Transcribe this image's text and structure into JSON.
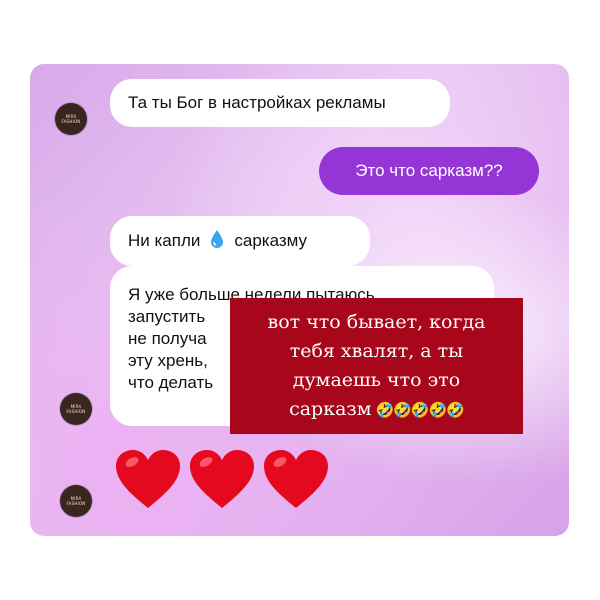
{
  "avatar": {
    "brand_line1": "MIRA",
    "brand_line2": "FASHION"
  },
  "messages": {
    "m1": "Та ты Бог в настройках рекламы",
    "m2": "Это что сарказм??",
    "m3_before": "Ни капли",
    "m3_emoji": "💧",
    "m3_after": "сарказму",
    "m4_lines": [
      "Я уже больше недели пытаюсь",
      "запустить",
      "не получа",
      "эту хрень,",
      "что делать"
    ]
  },
  "overlay": {
    "lines": [
      "вот что бывает, когда",
      "тебя хвалят, а ты",
      "думаешь что это"
    ],
    "last_word": "сарказм",
    "emojis": "🤣🤣🤣🤣🤣"
  },
  "hearts": [
    "heart",
    "heart",
    "heart"
  ],
  "colors": {
    "outgoing": "#9535d6",
    "overlay": "#a8061a",
    "heart": "#e5091f"
  }
}
